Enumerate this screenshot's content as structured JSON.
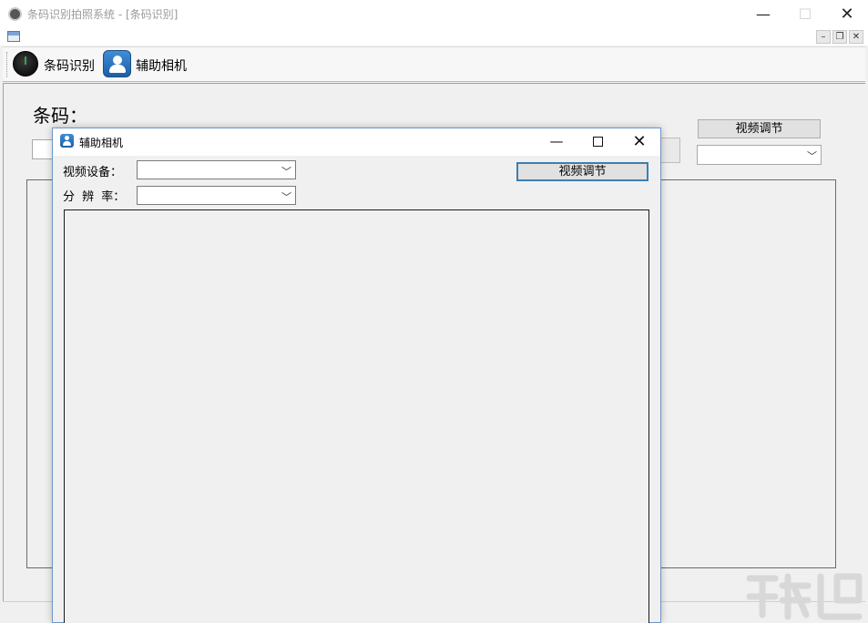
{
  "main_window": {
    "title": "条码识别拍照系统 - [条码识别]",
    "caption_buttons": {
      "minimize": "—",
      "maximize": "☐",
      "close": "✕"
    }
  },
  "mdi_buttons": {
    "minimize": "–",
    "restore": "❐",
    "close": "✕"
  },
  "toolbar": {
    "items": [
      {
        "label": "条码识别",
        "icon": "power-button-icon"
      },
      {
        "label": "辅助相机",
        "icon": "user-icon"
      }
    ]
  },
  "barcode_panel": {
    "label": "条码：",
    "video_adjust_label": "视频调节",
    "resolution_value": ""
  },
  "dialog": {
    "title": "辅助相机",
    "caption_buttons": {
      "minimize": "—",
      "close": "✕"
    },
    "video_device_label": "视频设备：",
    "video_device_value": "",
    "resolution_label": "分 辨 率：",
    "resolution_value": "",
    "video_adjust_label": "视频调节"
  },
  "colors": {
    "accent_border": "#3c7fb1",
    "dialog_border": "#6e95c4",
    "icon_blue": "#1d5ea3"
  }
}
